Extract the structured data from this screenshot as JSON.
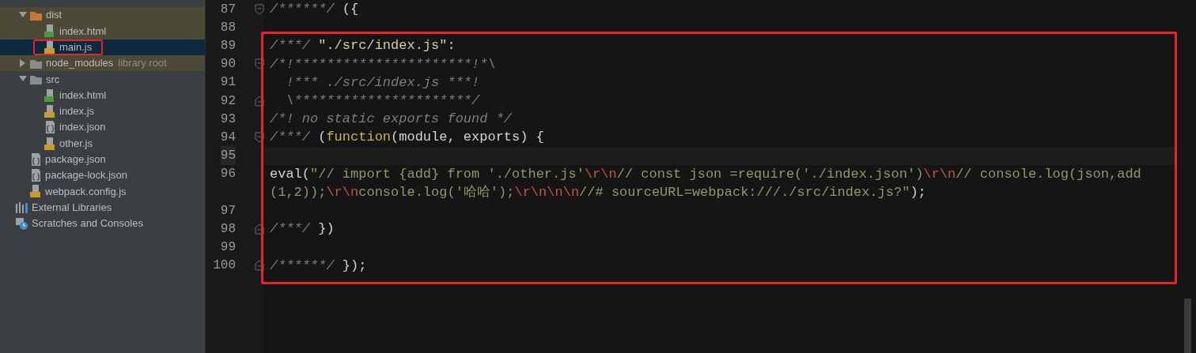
{
  "project_tree": {
    "children": [
      {
        "name": "dist",
        "kind": "folder",
        "color": "#c8773a",
        "expanded": true,
        "selected": false,
        "tinted": true,
        "children": [
          {
            "name": "index.html",
            "kind": "html",
            "selected": false,
            "tinted": true
          },
          {
            "name": "main.js",
            "kind": "js",
            "selected": true,
            "tinted": false,
            "annotated": true
          }
        ]
      },
      {
        "name": "node_modules",
        "kind": "folder",
        "color": "#8a8d90",
        "expanded": false,
        "selected": false,
        "tinted": true,
        "note": "library root"
      },
      {
        "name": "src",
        "kind": "folder",
        "color": "#8a8d90",
        "expanded": true,
        "selected": false,
        "tinted": false,
        "children": [
          {
            "name": "index.html",
            "kind": "html",
            "selected": false,
            "tinted": false
          },
          {
            "name": "index.js",
            "kind": "js",
            "selected": false,
            "tinted": false
          },
          {
            "name": "index.json",
            "kind": "json",
            "selected": false,
            "tinted": false
          },
          {
            "name": "other.js",
            "kind": "js",
            "selected": false,
            "tinted": false
          }
        ]
      },
      {
        "name": "package.json",
        "kind": "json",
        "selected": false,
        "tinted": false
      },
      {
        "name": "package-lock.json",
        "kind": "json",
        "selected": false,
        "tinted": false
      },
      {
        "name": "webpack.config.js",
        "kind": "js",
        "selected": false,
        "tinted": false
      }
    ]
  },
  "other_items": [
    {
      "name": "External Libraries",
      "kind": "libraries",
      "selected": false,
      "tinted": false
    },
    {
      "name": "Scratches and Consoles",
      "kind": "scratches",
      "selected": false,
      "tinted": false
    }
  ],
  "editor": {
    "lines": [
      {
        "number": "87",
        "kind": "fold_start",
        "current": false,
        "rows": [
          {
            "tokens": [
              {
                "kind": "comment",
                "t": "/******/"
              },
              {
                "kind": "plain",
                "t": " ({"
              }
            ]
          }
        ]
      },
      {
        "number": "88",
        "kind": "line",
        "current": false
      }
    ],
    "annotation_box": {
      "lines": [
        {
          "number": "89",
          "kind": "line",
          "current": false,
          "rows": [
            {
              "tokens": [
                {
                  "kind": "comment",
                  "t": "/***/ "
                },
                {
                  "kind": "key",
                  "t": "\"./src/index.js\""
                },
                {
                  "kind": "plain",
                  "t": ":"
                }
              ]
            }
          ]
        },
        {
          "number": "90",
          "kind": "fold_start",
          "current": false,
          "rows": [
            {
              "tokens": [
                {
                  "kind": "comment",
                  "t": "/*!**********************!*\\"
                }
              ]
            }
          ]
        },
        {
          "number": "91",
          "kind": "line",
          "current": false,
          "rows": [
            {
              "tokens": [
                {
                  "kind": "comment",
                  "t": "  !*** ./src/index.js ***!"
                }
              ]
            }
          ]
        },
        {
          "number": "92",
          "kind": "fold_end",
          "current": false,
          "rows": [
            {
              "tokens": [
                {
                  "kind": "comment",
                  "t": "  \\**********************/"
                }
              ]
            }
          ]
        },
        {
          "number": "93",
          "kind": "line",
          "current": false,
          "rows": [
            {
              "tokens": [
                {
                  "kind": "comment",
                  "t": "/*! no static exports found */"
                }
              ]
            }
          ]
        },
        {
          "number": "94",
          "kind": "fold_start",
          "current": false,
          "rows": [
            {
              "tokens": [
                {
                  "kind": "comment",
                  "t": "/***/ "
                },
                {
                  "kind": "plain",
                  "t": "("
                },
                {
                  "kind": "keyword",
                  "t": "function"
                },
                {
                  "kind": "plain",
                  "t": "(module, exports) {"
                }
              ]
            }
          ]
        },
        {
          "number": "95",
          "kind": "line",
          "current": true
        },
        {
          "number": "96",
          "kind": "line",
          "current": false,
          "rows": [
            {
              "tokens": [
                {
                  "kind": "plain",
                  "t": "eval("
                },
                {
                  "kind": "string",
                  "t": "\"// import {add} from './other.js'"
                },
                {
                  "kind": "escape",
                  "t": "\\r\\n"
                },
                {
                  "kind": "string",
                  "t": "// const json =require('./index.json')"
                },
                {
                  "kind": "escape",
                  "t": "\\r\\n"
                },
                {
                  "kind": "string",
                  "t": "// console.log(json,add"
                }
              ]
            },
            {
              "tokens": [
                {
                  "kind": "string",
                  "t": "(1,2));"
                },
                {
                  "kind": "escape",
                  "t": "\\r\\n"
                },
                {
                  "kind": "string",
                  "t": "console.log('哈哈');"
                },
                {
                  "kind": "escape",
                  "t": "\\r\\n\\n\\n"
                },
                {
                  "kind": "string",
                  "t": "//# sourceURL=webpack:///./src/index.js?\""
                },
                {
                  "kind": "plain",
                  "t": ");"
                }
              ]
            }
          ]
        },
        {
          "number": "97",
          "kind": "line",
          "current": false
        },
        {
          "number": "98",
          "kind": "fold_end",
          "current": false,
          "rows": [
            {
              "tokens": [
                {
                  "kind": "comment",
                  "t": "/***/ "
                },
                {
                  "kind": "plain",
                  "t": "})"
                }
              ]
            }
          ]
        },
        {
          "number": "99",
          "kind": "line",
          "current": false
        },
        {
          "number": "100",
          "kind": "fold_end",
          "current": false,
          "rows": [
            {
              "tokens": [
                {
                  "kind": "comment",
                  "t": "/******/ "
                },
                {
                  "kind": "plain",
                  "t": "});"
                }
              ]
            }
          ]
        }
      ]
    }
  }
}
